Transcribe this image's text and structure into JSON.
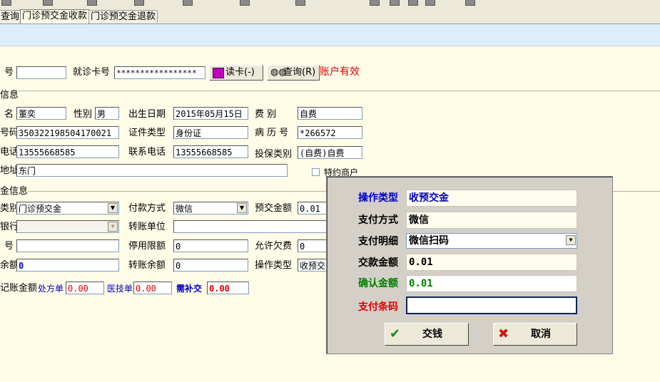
{
  "tabs": [
    "查询",
    "门诊预交金收款",
    "门诊预交金退款"
  ],
  "card": {
    "no_label": "号",
    "card_label": "就诊卡号",
    "card_value": "*****************",
    "read_card_button": "读卡(-)",
    "query_button": "查询(R)",
    "account_status": "账户有效"
  },
  "patient": {
    "section_label": "信息",
    "name_label": "名",
    "name_value": "董奕",
    "gender_label": "性别",
    "gender_value": "男",
    "dob_label": "出生日期",
    "dob_value": "2015年05月15日",
    "fee_label": "费    别",
    "fee_value": "自费",
    "id_label": "号码",
    "id_value": "350322198504170021",
    "cert_type_label": "证件类型",
    "cert_type_value": "身份证",
    "record_label": "病 历 号",
    "record_value": "*266572",
    "phone_label": "电话",
    "phone_value": "13555668585",
    "contact_label": "联系电话",
    "contact_value": "13555668585",
    "insurance_label": "投保类别",
    "insurance_value": "(自费)自费",
    "address_label": "地址",
    "address_value": "东门",
    "special_merchant_label": "特约商户"
  },
  "payment": {
    "section_label": "金信息",
    "type_label": "类别",
    "type_value": "门诊预交金",
    "method_label": "付款方式",
    "method_value": "微信",
    "prepay_label": "预交金额",
    "prepay_value": "0.01",
    "bank_label": "银行",
    "bank_value": "",
    "transfer_unit_label": "转账单位",
    "transfer_unit_value": "",
    "acct_label": "号",
    "acct_value": "",
    "stop_limit_label": "停用限额",
    "stop_limit_value": "0",
    "allow_debt_label": "允许欠费",
    "allow_debt_value": "0",
    "balance_label": "余额",
    "balance_value": "0",
    "transfer_balance_label": "转账余额",
    "transfer_balance_value": "0",
    "op_type_label": "操作类型",
    "op_type_value": "收预交",
    "bill_amount_label": "记账金额",
    "prescription_label": "处方单",
    "prescription_value": "0.00",
    "tech_label": "医技单",
    "tech_value": "0.00",
    "needed_label": "需补交",
    "needed_value": "0.00"
  },
  "dialog": {
    "op_type_label": "操作类型",
    "op_type_value": "收预交金",
    "pay_method_label": "支付方式",
    "pay_method_value": "微信",
    "pay_detail_label": "支付明细",
    "pay_detail_value": "微信扫码",
    "amount_label": "交款金额",
    "amount_value": "0.01",
    "confirm_label": "确认金额",
    "confirm_value": "0.01",
    "barcode_label": "支付条码",
    "barcode_value": "",
    "ok_button": "交钱",
    "cancel_button": "取消"
  },
  "colors": {
    "background": "#FFFCE8",
    "band": "#DEEDFC",
    "status_red": "#E00000",
    "label_blue": "#0000C0",
    "label_green": "#008000",
    "label_red": "#E00000"
  }
}
